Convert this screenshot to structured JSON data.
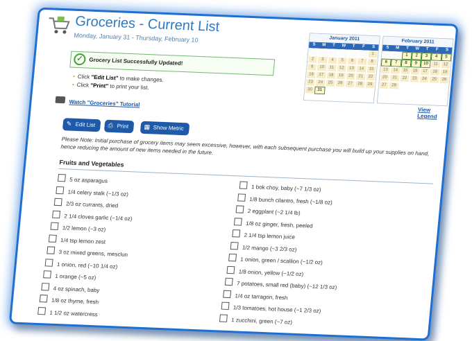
{
  "header": {
    "title": "Groceries - Current List",
    "subtitle": "Monday, January 31 - Thursday, February 10"
  },
  "status": {
    "message": "Grocery List Successfully Updated!"
  },
  "instructions": [
    {
      "pre": "Click ",
      "bold": "\"Edit List\"",
      "post": " to make changes."
    },
    {
      "pre": "Click ",
      "bold": "\"Print\"",
      "post": " to print your list."
    }
  ],
  "tutorial_link": "Watch \"Groceries\" Tutorial",
  "calendars": [
    {
      "month": "January 2011",
      "dow": [
        "S",
        "M",
        "T",
        "W",
        "T",
        "F",
        "S"
      ],
      "days": [
        "",
        "",
        "",
        "",
        "",
        "",
        "1",
        "2",
        "3",
        "4",
        "5",
        "6",
        "7",
        "8",
        "9",
        "10",
        "11",
        "12",
        "13",
        "14",
        "15",
        "16",
        "17",
        "18",
        "19",
        "20",
        "21",
        "22",
        "23",
        "24",
        "25",
        "26",
        "27",
        "28",
        "29",
        "30",
        "31"
      ],
      "selected": [
        "31"
      ]
    },
    {
      "month": "February 2011",
      "dow": [
        "S",
        "M",
        "T",
        "W",
        "T",
        "F",
        "S"
      ],
      "days": [
        "",
        "",
        "1",
        "2",
        "3",
        "4",
        "5",
        "6",
        "7",
        "8",
        "9",
        "10",
        "11",
        "12",
        "13",
        "14",
        "15",
        "16",
        "17",
        "18",
        "19",
        "20",
        "21",
        "22",
        "23",
        "24",
        "25",
        "26",
        "27",
        "28"
      ],
      "selected": [
        "1",
        "2",
        "3",
        "4",
        "5",
        "6",
        "7",
        "8",
        "9",
        "10"
      ]
    }
  ],
  "view_legend": "View Legend",
  "toolbar": {
    "edit_label": "Edit List",
    "print_label": "Print",
    "metric_label": "Show Metric"
  },
  "note": "Please Note: Initial purchase of grocery items may seem excessive, however, with each subsequent purchase you will build up your supplies on hand, hence reducing the amount of new items needed in the future.",
  "section_title": "Fruits and Vegetables",
  "items_left": [
    "5 oz asparagus",
    "1/4 celery stalk (~1/3 oz)",
    "2/3 oz currants, dried",
    "2 1/4 cloves garlic (~1/4 oz)",
    "1/2 lemon (~3 oz)",
    "1/4 tsp lemon zest",
    "3 oz mixed greens, mesclun",
    "1 onion, red (~10 1/4 oz)",
    "1 orange (~5 oz)",
    "4 oz spinach, baby",
    "1/8 oz thyme, fresh",
    "1 1/2 oz watercress"
  ],
  "items_right": [
    "1 bok choy, baby (~7 1/3 oz)",
    "1/8 bunch cilantro, fresh (~1/8 oz)",
    "2 eggplant (~2 1/4 lb)",
    "1/8 oz ginger, fresh, peeled",
    "2 1/4 tsp lemon juice",
    "1/2 mango (~3 2/3 oz)",
    "1 onion, green / scallion (~1/2 oz)",
    "1/8 onion, yellow (~1/2 oz)",
    "7 potatoes, small red (baby) (~12 1/3 oz)",
    "1/4 oz tarragon, fresh",
    "1/3 tomatoes, hot house (~1 2/3 oz)",
    "1 zucchini, green (~7 oz)"
  ]
}
